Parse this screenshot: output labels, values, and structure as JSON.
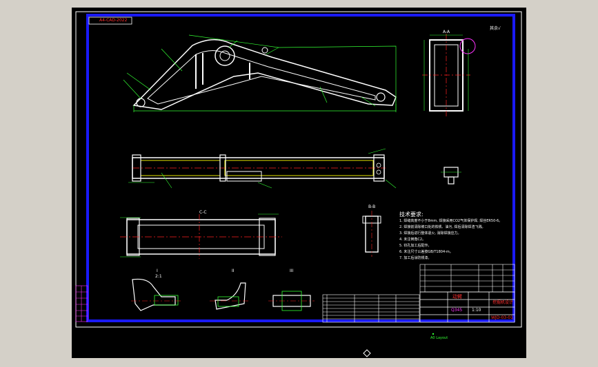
{
  "drawing": {
    "top_left_stamp": "A4-CAD-2022",
    "top_right_note": "其余√",
    "view_labels": {
      "section_AA": "A-A",
      "section_BB": "B-B",
      "section_CC": "C-C",
      "detail_1": "I",
      "detail_2": "II",
      "detail_3": "III",
      "scale_1": "2:1"
    },
    "tech_requirements": {
      "title": "技术要求:",
      "lines": [
        "1. 焊缝高度不小于8mm, 焊接采用CO2气体保护焊, 焊丝ER50-6。",
        "2. 焊接前清除坡口处的铁锈、油污, 焊后清除焊渣飞溅。",
        "3. 焊接后进行整体退火, 消除焊接应力。",
        "4. 未注倒角C2。",
        "5. 铰孔加工后配作。",
        "6. 未注尺寸公差按GB/T1804-m。",
        "7. 加工后涂防锈漆。"
      ]
    },
    "title_block": {
      "part_name": "动臂",
      "drawing_no": "WJD-03-01",
      "company": "挖掘机设计",
      "material": "Q345",
      "scale": "1:10"
    },
    "bottom_marker": "A0 Layout"
  },
  "colors": {
    "background": "#000000",
    "frame": "#1a1aff",
    "geometry": "#ffffff",
    "dimension": "#33ff33",
    "centerline": "#ff2020",
    "hidden": "#ffff00",
    "annotation": "#ff33ff"
  }
}
